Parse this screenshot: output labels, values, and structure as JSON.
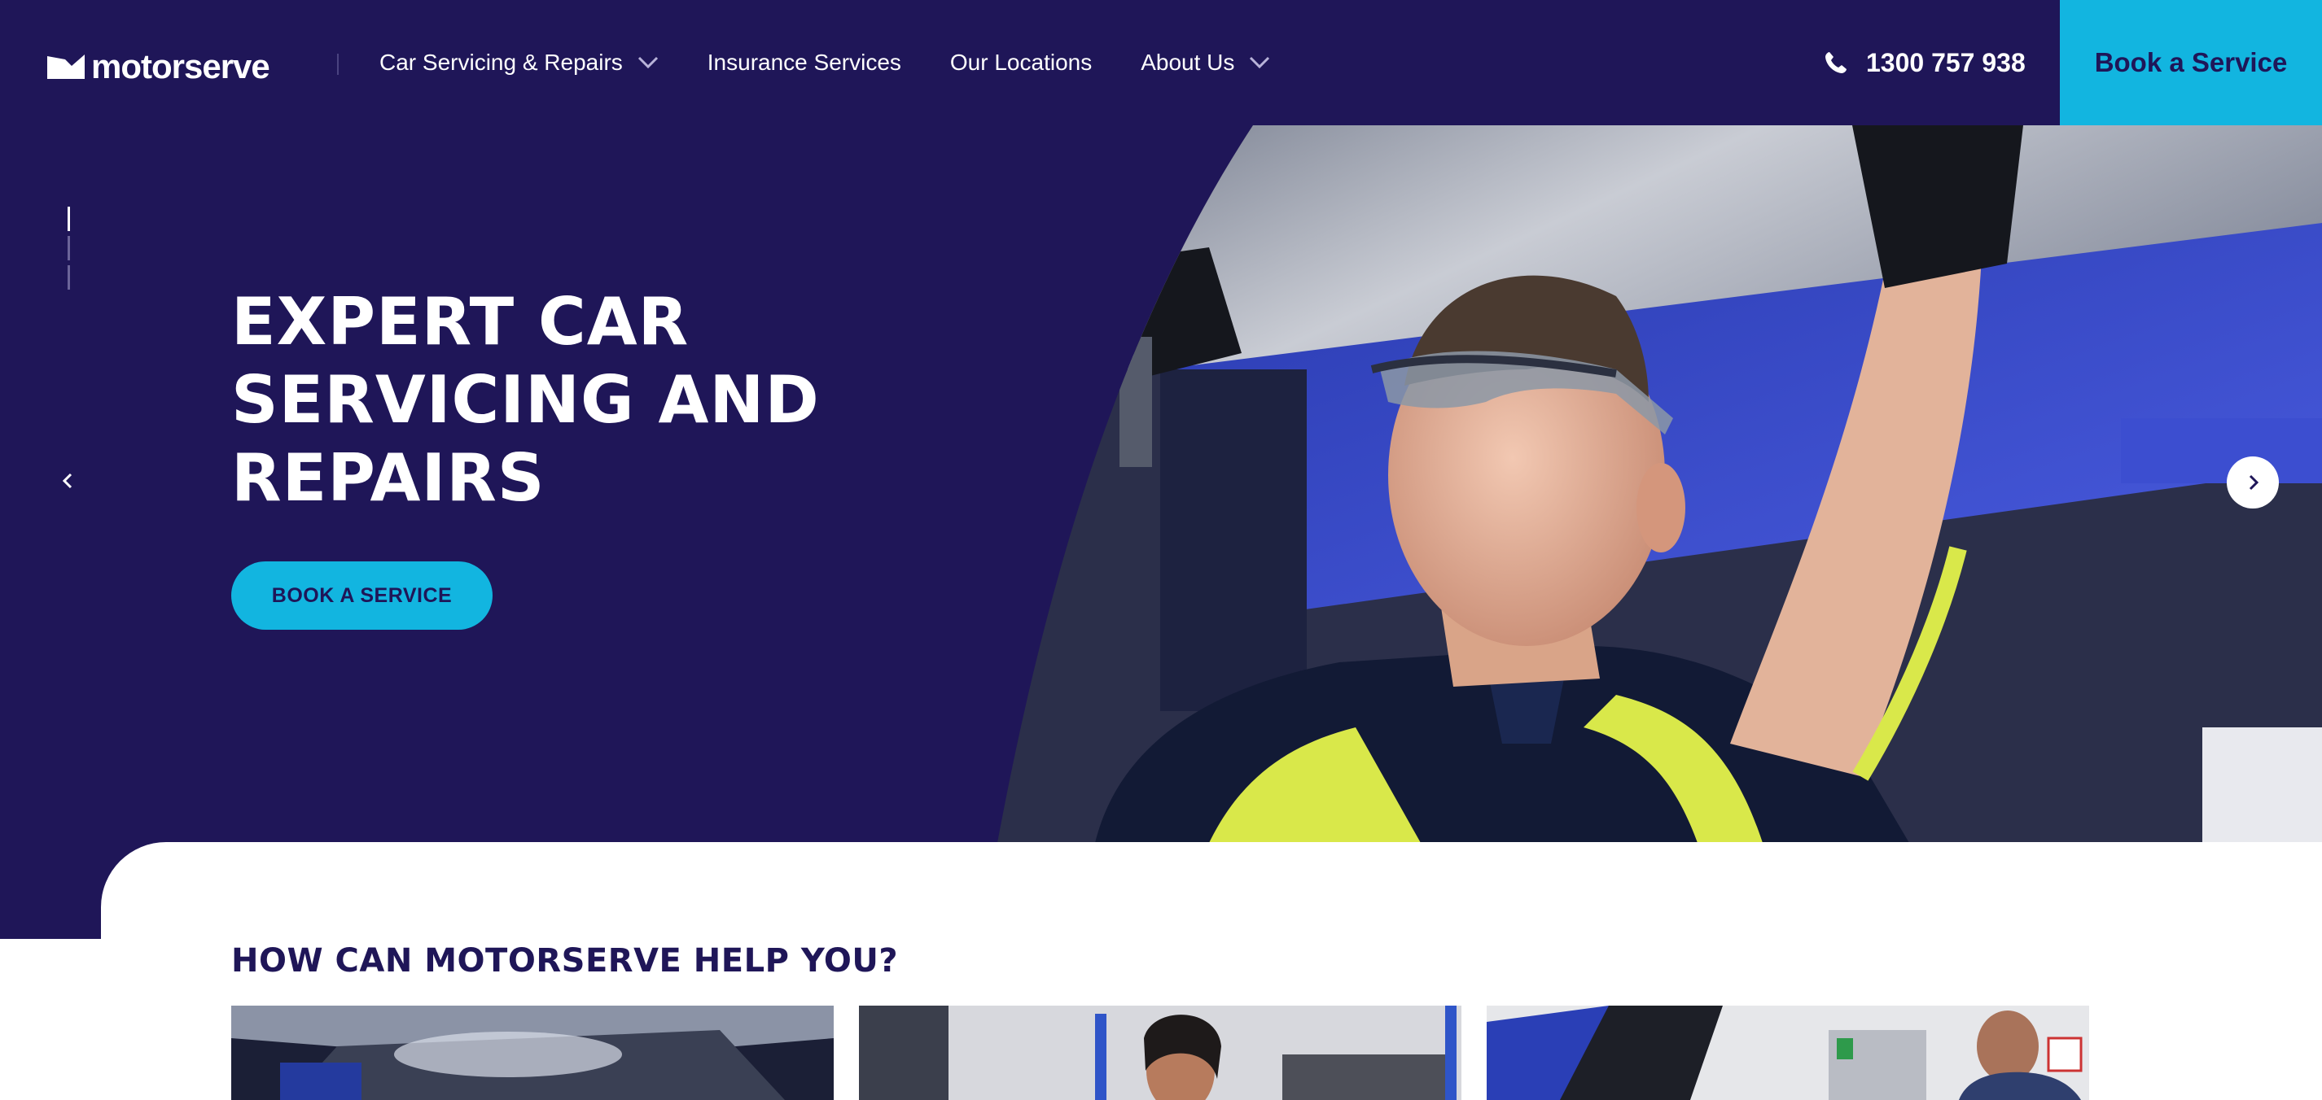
{
  "nav": {
    "logo_text": "motorserve",
    "items": [
      {
        "label": "Car Servicing & Repairs",
        "has_dropdown": true
      },
      {
        "label": "Insurance Services",
        "has_dropdown": false
      },
      {
        "label": "Our Locations",
        "has_dropdown": false
      },
      {
        "label": "About Us",
        "has_dropdown": true
      }
    ],
    "phone": "1300 757 938",
    "book_label": "Book a Service"
  },
  "hero": {
    "title_lines": [
      "EXPERT CAR",
      "SERVICING AND",
      "REPAIRS"
    ],
    "cta_label": "BOOK A SERVICE",
    "slides_total": 3,
    "active_slide": 1,
    "photo_icon": "mechanic-under-car-photo"
  },
  "section": {
    "title": "HOW CAN MOTORSERVE HELP YOU?",
    "cards": [
      {
        "image_icon": "car-underside-photo"
      },
      {
        "image_icon": "workshop-technician-photo"
      },
      {
        "image_icon": "engine-bay-photo"
      }
    ]
  },
  "colors": {
    "navy": "#1f1658",
    "accent": "#12b5e0",
    "white": "#ffffff"
  }
}
